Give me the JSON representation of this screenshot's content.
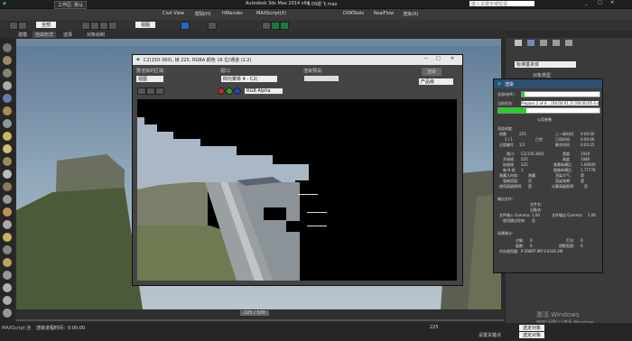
{
  "window": {
    "workspace": "工作区: 默认",
    "app_title": "Autodesk 3ds Max  2014 x64",
    "file_name": "9.09逐飞.max",
    "search_placeholder": "键入关键字或短语"
  },
  "menubar": {
    "items": [
      "Civil View",
      "帮助(H)",
      "HIRender",
      "MAXScript(X)",
      "DOKTools",
      "RealFlow",
      "渲染(R)"
    ]
  },
  "toolbar": {
    "selection_filter": "全部",
    "ref_coord": "视图"
  },
  "ribbon": {
    "items": [
      "建模",
      "自由形式",
      "选择",
      "对象绘制"
    ]
  },
  "framebuffer": {
    "title": "C2(150-360), 帧 225, RGBA 颜色 16 位/通道 (1:2)",
    "label_area": "要渲染的区域:",
    "label_viewport": "视口:",
    "label_preset": "渲染预设:",
    "area_value": "视图",
    "viewport_value": "四元菜单 4 - C2(",
    "render_btn": "渲染",
    "product_value": "产品级",
    "channel_value": "RGB Alpha"
  },
  "render_progress": {
    "title": "渲染",
    "overall_label": "全部(帧#):",
    "current_task_label": "当前任务:",
    "current_task_value": "Prepass 2 of 4... [00:00:01.2] [00:00:05.4 est]",
    "overall_progress": 0.04,
    "task_progress": 0.28,
    "common_params": "公用参数",
    "render_progress_label": "渲染进度:",
    "frame_num_label": "帧数",
    "frame_num": "225",
    "frame_count_label": "已完",
    "last_frame_time_label": "上一帧时间",
    "last_frame_time": "0:00:00",
    "elapsed_label": "已用时间",
    "elapsed_value": "0:00:00",
    "remaining_label": "剩余时间",
    "remaining_value": "0:03:25",
    "frames_done": "1 / 1",
    "pass_label": "过程编号",
    "pass_value": "1/1",
    "viewport_label": "视口:",
    "viewport_value": "C2(150-360)",
    "width_label": "宽度",
    "width_value": "1920",
    "start_frame_label": "开始帧",
    "start_frame": "225",
    "height_label": "高度",
    "height_value": "1080",
    "end_frame_label": "结束帧",
    "end_frame": "225",
    "pixel_aspect_label": "像素纵横比",
    "pixel_aspect": "1.00000",
    "nth_frame_label": "每 N 帧",
    "nth_frame": "1",
    "image_aspect_label": "图像纵横比",
    "image_aspect": "1.77778",
    "hidden_label": "隐藏几何体:",
    "hidden_value": "隐藏",
    "atmosphere_label": "渲染大气:",
    "atmosphere_value": "是",
    "force_2sided_label": "强制双面:",
    "force_2sided_value": "否",
    "effects_label": "渲染效果:",
    "effects_value": "是",
    "displace_label": "使用高级照明:",
    "displace_value": "是",
    "compute_label": "计算高级照明:",
    "compute_value": "否",
    "output_header": "输出文件:",
    "file_name_label": "文件名:",
    "device_label": "设备名:",
    "gamma_label": "文件输入 Gamma:",
    "gamma_value": "1.00",
    "output_gamma_label": "文件输出 Gamma:",
    "output_gamma_value": "1.00",
    "use_skip_label": "使用跳过现有:",
    "use_skip_value": "否",
    "scene_header": "场景统计:",
    "objects_label": "对象:",
    "objects_value": "0",
    "lights_label": "灯光:",
    "lights_value": "0",
    "faces_label": "面数:",
    "faces_value": "0",
    "shadows_label": "阴影贴图:",
    "shadows_value": "0",
    "memory_label": "内存使用量:",
    "memory_value": "P:29897.9M V:4336.4M"
  },
  "cmdpanel": {
    "dropdown": "标准基本体",
    "section": "对象类型"
  },
  "timeline": {
    "frame_label": "225 / 500"
  },
  "status": {
    "script_label": "MAXScript 迷",
    "prompt": "渲染进程时间：0:00:00",
    "set_key": "设置关键点",
    "filter": "选定对象",
    "frame_field": "225",
    "selected_label": "选定对象"
  },
  "watermark": {
    "line1": "激活 Windows",
    "line2": "转到\"设置\"以激活 Windows。"
  },
  "colors": {
    "accent_green": "#1fd41f",
    "title_blue": "#2d5072",
    "render_red": "#cc2222"
  }
}
